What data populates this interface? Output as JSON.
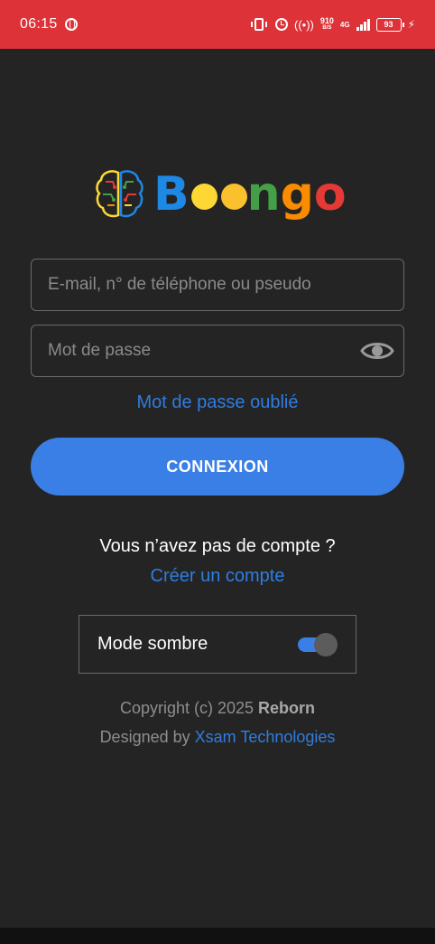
{
  "status_bar": {
    "time": "06:15",
    "net_speed": "910",
    "net_speed_unit": "B/S",
    "network_type": "4G",
    "battery": "93",
    "background_color": "#dc3238"
  },
  "logo": {
    "icon": "brain-icon",
    "letters": [
      "B",
      "o",
      "o",
      "n",
      "g",
      "o"
    ],
    "colors": [
      "#1e88e5",
      "#fdd835",
      "#fbc02d",
      "#43a047",
      "#fb8c00",
      "#e53935"
    ]
  },
  "login": {
    "username_placeholder": "E-mail, n° de téléphone ou pseudo",
    "password_placeholder": "Mot de passe",
    "forgot_password": "Mot de passe oublié",
    "connect_button": "CONNEXION",
    "no_account_text": "Vous n’avez pas de compte ?",
    "create_account": "Créer un compte"
  },
  "settings": {
    "dark_mode_label": "Mode sombre",
    "dark_mode_enabled": true
  },
  "footer": {
    "copyright_prefix": "Copyright (c) 2025",
    "copyright_owner": "Reborn",
    "designed_prefix": "Designed by",
    "designer": "Xsam Technologies"
  },
  "theme": {
    "accent": "#3a7fe6",
    "link": "#2f7de1",
    "background": "#242424"
  }
}
